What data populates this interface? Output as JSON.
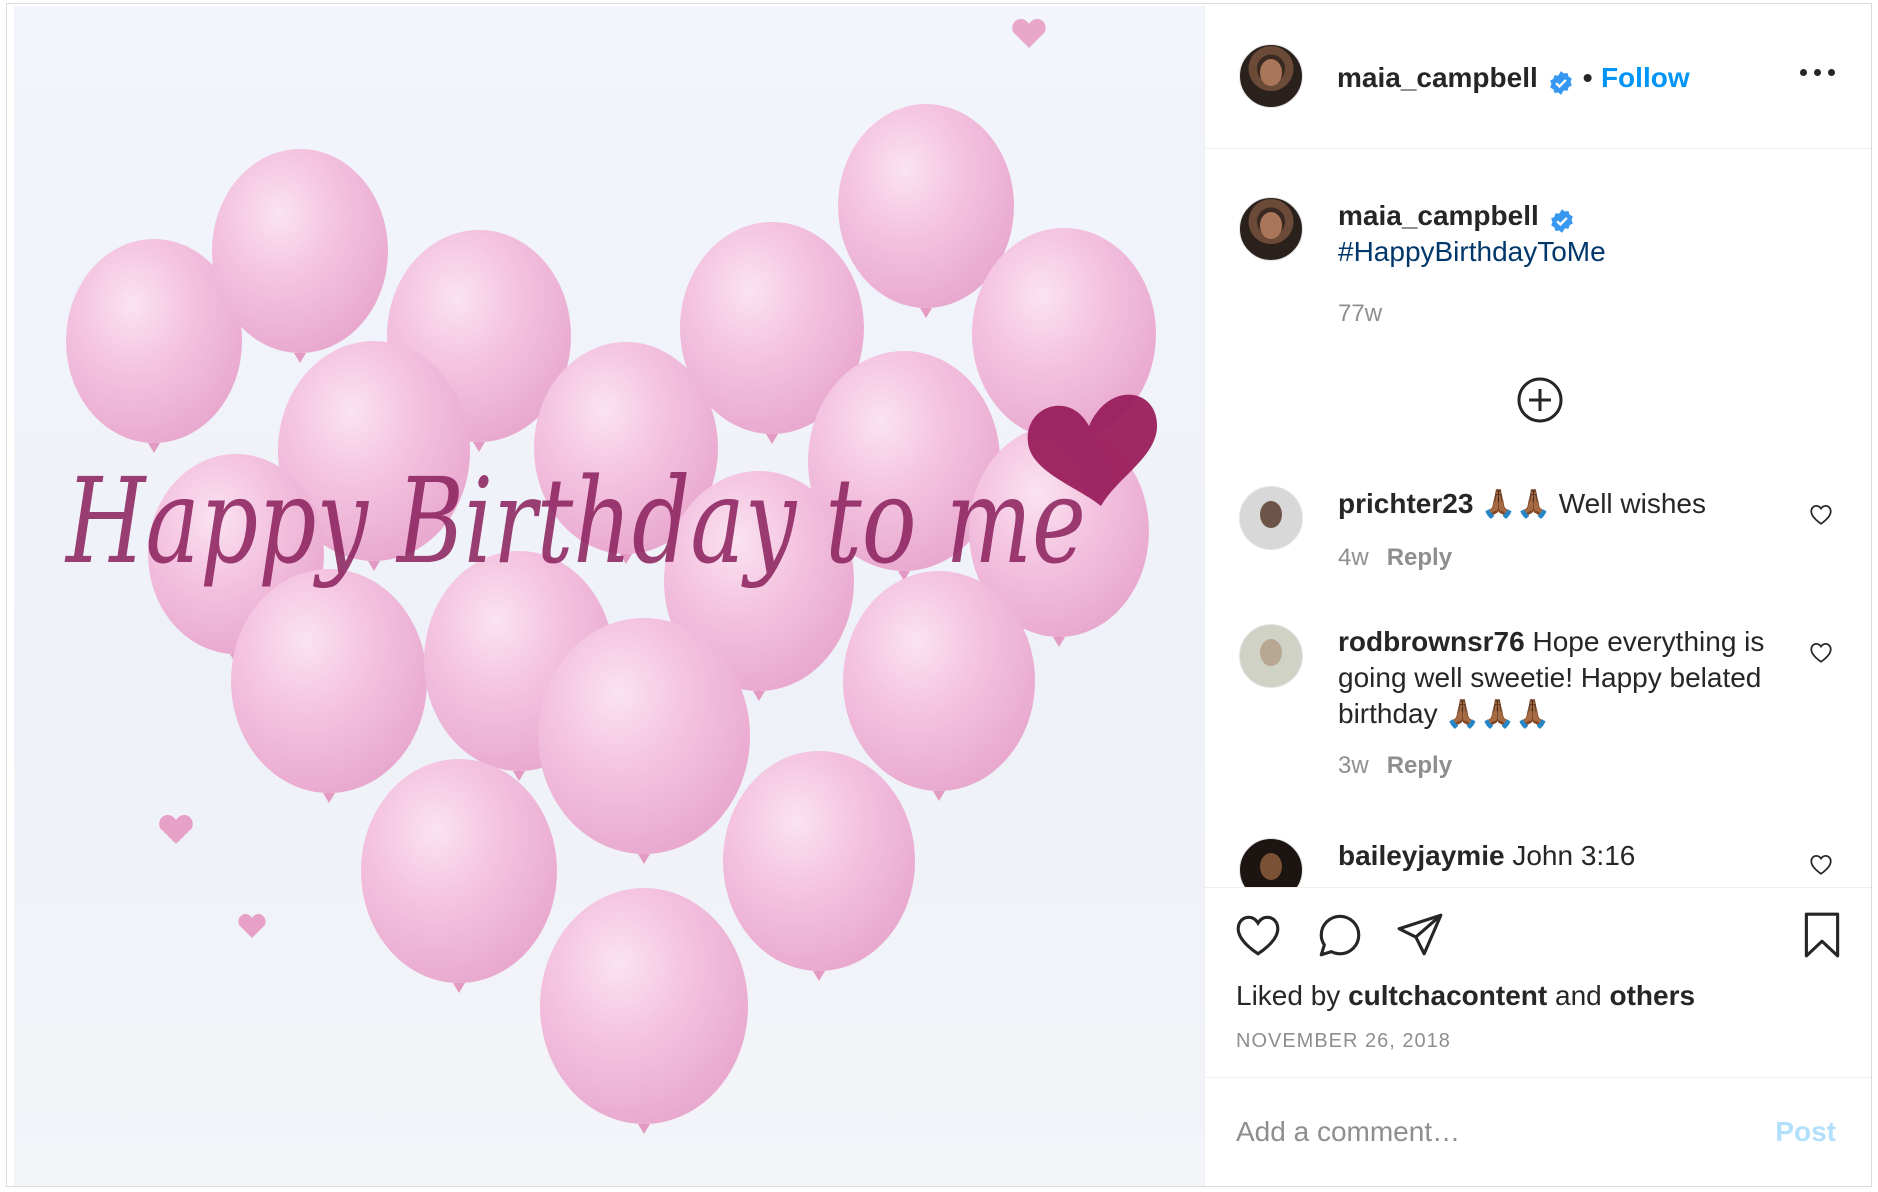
{
  "media": {
    "overlay_text": "Happy Birthday to me",
    "balloon_color": "#f3c6e2",
    "text_color": "#8a1f5c"
  },
  "header": {
    "username": "maia_campbell",
    "separator": "•",
    "follow_label": "Follow"
  },
  "caption": {
    "username": "maia_campbell",
    "text": "#HappyBirthdayToMe",
    "age": "77w"
  },
  "comments": [
    {
      "username": "prichter23",
      "text": "🙏🏾🙏🏾 Well wishes",
      "age": "4w",
      "reply_label": "Reply"
    },
    {
      "username": "rodbrownsr76",
      "text": "Hope everything is going well sweetie! Happy belated birthday 🙏🏾🙏🏾🙏🏾",
      "age": "3w",
      "reply_label": "Reply"
    },
    {
      "username": "baileyjaymie",
      "text": "John 3:16"
    }
  ],
  "likes": {
    "prefix": "Liked by",
    "user": "cultchacontent",
    "connector": "and",
    "others": "others"
  },
  "post_date": "NOVEMBER 26, 2018",
  "comment_box": {
    "placeholder": "Add a comment…",
    "post_label": "Post"
  },
  "colors": {
    "accent": "#0095f6",
    "hashtag": "#00376b",
    "muted": "#8e8e8e",
    "post_disabled": "#b2dffc"
  }
}
